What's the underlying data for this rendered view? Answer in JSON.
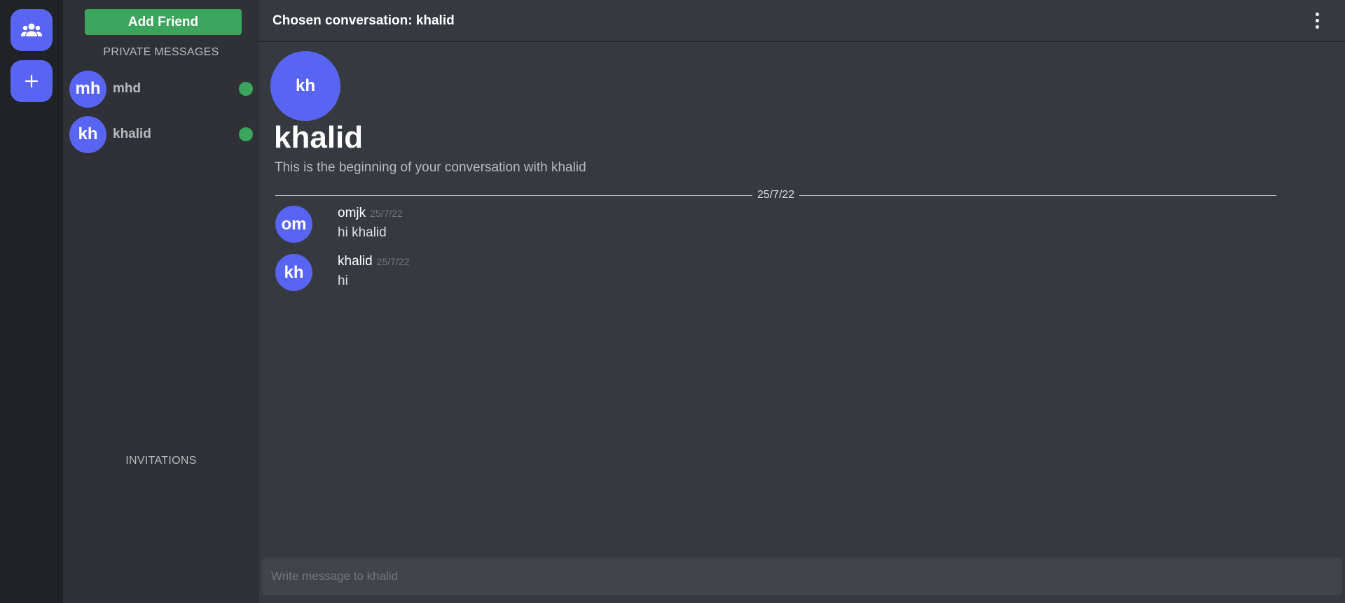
{
  "rail": {
    "items": [
      {
        "icon": "friends-icon"
      },
      {
        "icon": "plus-icon"
      }
    ]
  },
  "sidebar": {
    "add_friend_label": "Add Friend",
    "private_messages_label": "PRIVATE MESSAGES",
    "invitations_label": "INVITATIONS",
    "dms": [
      {
        "initials": "mh",
        "name": "mhd",
        "status": "online"
      },
      {
        "initials": "kh",
        "name": "khalid",
        "status": "online"
      }
    ]
  },
  "header": {
    "title": "Chosen conversation: khalid",
    "menu_icon": "more-vertical-icon"
  },
  "conversation": {
    "avatar_initials": "kh",
    "name": "khalid",
    "subtitle": "This is the beginning of your conversation with khalid",
    "date_divider": "25/7/22",
    "messages": [
      {
        "initials": "om",
        "author": "omjk",
        "time": "25/7/22",
        "text": "hi khalid"
      },
      {
        "initials": "kh",
        "author": "khalid",
        "time": "25/7/22",
        "text": "hi"
      }
    ]
  },
  "composer": {
    "placeholder": "Write message to khalid",
    "value": ""
  },
  "colors": {
    "accent": "#5865f2",
    "online": "#3ba55d",
    "add_friend": "#3ba55d"
  }
}
